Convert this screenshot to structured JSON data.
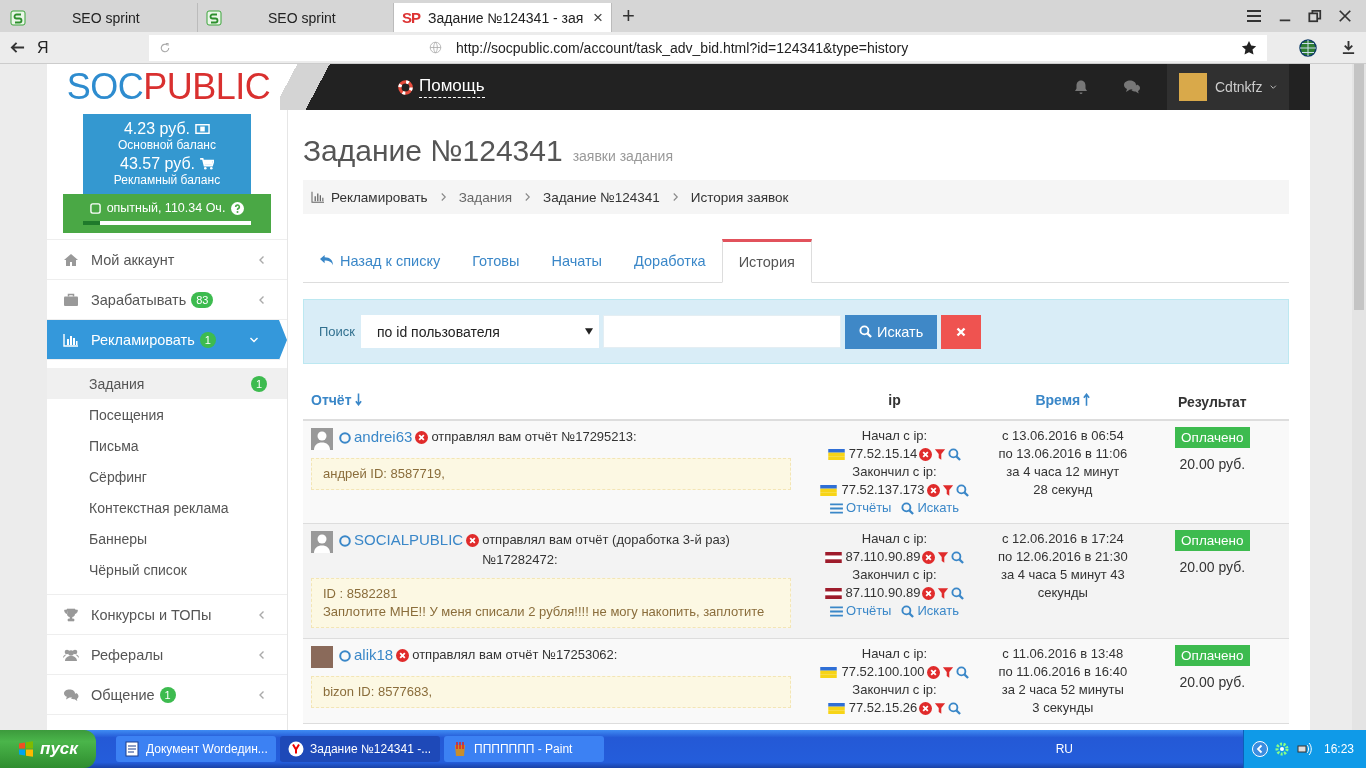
{
  "browser": {
    "tabs": [
      {
        "kind": "seo",
        "label": "SEO sprint",
        "selected": false
      },
      {
        "kind": "seo",
        "label": "SEO sprint",
        "selected": false
      },
      {
        "kind": "text",
        "icon_text": "SP",
        "label": "Задание №124341 - зая",
        "selected": true,
        "close": "×"
      }
    ],
    "new_tab": "+",
    "home": "Я",
    "url": "http://socpublic.com/account/task_adv_bid.html?id=124341&type=history"
  },
  "site": {
    "logo": {
      "part1": "SOC",
      "part2": "PUBLIC"
    },
    "help": "Помощь",
    "user": "Cdtnkfz"
  },
  "balance": {
    "main_amount": "4.23 руб.",
    "main_label": "Основной баланс",
    "ad_amount": "43.57 руб.",
    "ad_label": "Рекламный баланс",
    "rank": "опытный, 110.34 Оч.",
    "level": 0.1
  },
  "menu": [
    {
      "label": "Мой аккаунт",
      "selected": false,
      "expanded": false
    },
    {
      "label": "Зарабатывать",
      "badge": "83",
      "selected": false,
      "expanded": false
    },
    {
      "label": "Рекламировать",
      "badge": "1",
      "selected": true,
      "expanded": true,
      "children": [
        {
          "label": "Задания",
          "badge": "1",
          "selected": true
        },
        {
          "label": "Посещения",
          "selected": false
        },
        {
          "label": "Письма",
          "selected": false
        },
        {
          "label": "Сёрфинг",
          "selected": false
        },
        {
          "label": "Контекстная реклама",
          "selected": false
        },
        {
          "label": "Баннеры",
          "selected": false
        },
        {
          "label": "Чёрный список",
          "selected": false
        }
      ]
    },
    {
      "label": "Конкурсы и ТОПы",
      "selected": false,
      "expanded": false
    },
    {
      "label": "Рефералы",
      "selected": false,
      "expanded": false
    },
    {
      "label": "Общение",
      "badge": "1",
      "selected": false,
      "expanded": false
    }
  ],
  "page": {
    "title": "Задание №124341",
    "subtitle": "заявки задания",
    "breadcrumb": [
      "Рекламировать",
      "Задания",
      "Задание №124341",
      "История заявок"
    ]
  },
  "tabs": [
    {
      "kind": "back",
      "label": "Назад к списку",
      "selected": false
    },
    {
      "kind": "plain",
      "label": "Готовы",
      "selected": false
    },
    {
      "kind": "plain",
      "label": "Начаты",
      "selected": false
    },
    {
      "kind": "plain",
      "label": "Доработка",
      "selected": false
    },
    {
      "kind": "plain",
      "label": "История",
      "selected": true
    }
  ],
  "search": {
    "label": "Поиск",
    "select_value": "по id пользователя",
    "button": "Искать"
  },
  "table": {
    "columns": [
      {
        "label": "Отчёт",
        "kind": "descending"
      },
      {
        "label": "ip",
        "kind": "plain"
      },
      {
        "label": "Время",
        "kind": "ascending"
      },
      {
        "label": "Результат",
        "kind": "plain"
      }
    ],
    "rows": [
      {
        "kind": "silhouette",
        "user": "andrei63",
        "message": "отправлял вам отчёт №17295213:",
        "report": [
          "андрей ID: 8587719,"
        ],
        "start_label": "Начал с ip:",
        "start_ip": {
          "kind": "ukraine",
          "ip": "77.52.15.14"
        },
        "end_label": "Закончил с ip:",
        "end_ip": {
          "kind": "ukraine",
          "ip": "77.52.137.173"
        },
        "links": [
          "Отчёты",
          "Искать"
        ],
        "time": [
          "с 13.06.2016 в 06:54",
          "по 13.06.2016 в 11:06",
          "за 4 часа 12 минут 28 секунд"
        ],
        "status": "Оплачено",
        "amount": "20.00 руб."
      },
      {
        "kind": "silhouette",
        "user": "SOCIALPUBLIC",
        "message": "отправлял вам отчёт (доработка 3-й раз) №17282472:",
        "report": [
          "ID : 8582281",
          "Заплотите МНЕ!! У меня списали 2 рубля!!!! не могу накопить, заплотите"
        ],
        "start_label": "Начал с ip:",
        "start_ip": {
          "kind": "latvia",
          "ip": "87.110.90.89"
        },
        "end_label": "Закончил с ip:",
        "end_ip": {
          "kind": "latvia",
          "ip": "87.110.90.89"
        },
        "links": [
          "Отчёты",
          "Искать"
        ],
        "time": [
          "с 12.06.2016 в 17:24",
          "по 12.06.2016 в 21:30",
          "за 4 часа 5 минут 43 секунды"
        ],
        "status": "Оплачено",
        "amount": "20.00 руб."
      },
      {
        "kind": "photo",
        "user": "alik18",
        "message": "отправлял вам отчёт №17253062:",
        "report": [
          "bizon ID: 8577683,"
        ],
        "start_label": "Начал с ip:",
        "start_ip": {
          "kind": "ukraine",
          "ip": "77.52.100.100"
        },
        "end_label": "Закончил с ip:",
        "end_ip": {
          "kind": "ukraine",
          "ip": "77.52.15.26"
        },
        "time": [
          "с 11.06.2016 в 13:48",
          "по 11.06.2016 в 16:40",
          "за 2 часа 52 минуты 3 секунды"
        ],
        "status": "Оплачено",
        "amount": "20.00 руб."
      }
    ]
  },
  "taskbar": {
    "start": "пуск",
    "tasks": [
      {
        "label": "Документ Wordедин...",
        "selected": false
      },
      {
        "label": "Задание №124341 -...",
        "selected": true
      },
      {
        "label": "ППППППП - Paint",
        "selected": false
      }
    ],
    "lang": "RU",
    "clock": "16:23"
  }
}
